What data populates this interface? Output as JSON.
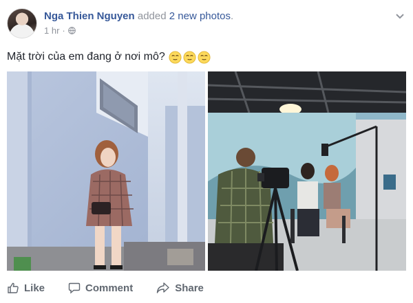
{
  "post": {
    "author": "Nga Thien Nguyen",
    "action_prefix": "added",
    "action_link": "2 new photos",
    "action_suffix": ".",
    "time": "1 hr",
    "privacy_icon": "globe-icon",
    "menu_icon": "chevron-down-icon",
    "text": "Mặt trời của em đang ở nơi mô?",
    "emoji": [
      "smiley-face-icon",
      "smiley-face-icon",
      "smiley-face-icon"
    ],
    "photos": [
      "photo-street-woman",
      "photo-tv-studio"
    ]
  },
  "actions": {
    "like": "Like",
    "comment": "Comment",
    "share": "Share"
  },
  "colors": {
    "link": "#365899",
    "muted": "#90949c",
    "action": "#606770"
  }
}
